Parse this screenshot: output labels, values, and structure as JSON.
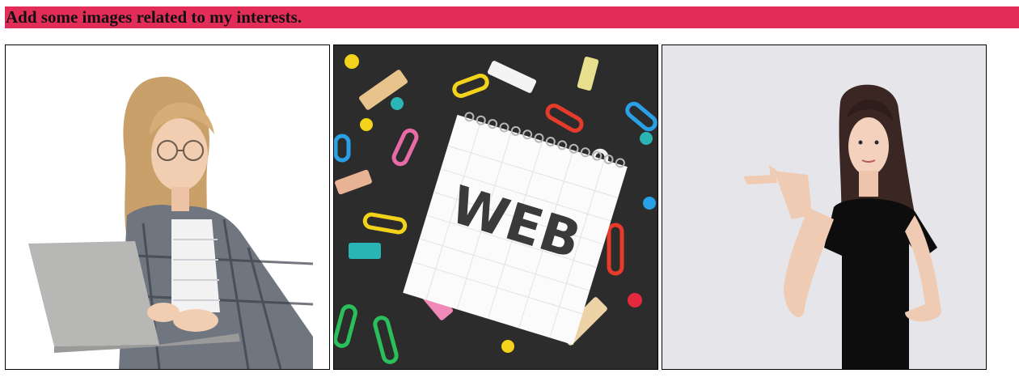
{
  "header": {
    "title": "Add some images related to my interests."
  },
  "gallery": {
    "images": [
      {
        "icon": "woman-with-laptop-photo",
        "subject": "woman with laptop"
      },
      {
        "icon": "web-notepad-photo",
        "subject": "notepad with clips and pins",
        "text": "WEB"
      },
      {
        "icon": "woman-pointing-photo",
        "subject": "woman pointing"
      }
    ]
  },
  "colors": {
    "header_bg": "#e22d59",
    "header_text": "#111111",
    "frame_border": "#000000"
  }
}
